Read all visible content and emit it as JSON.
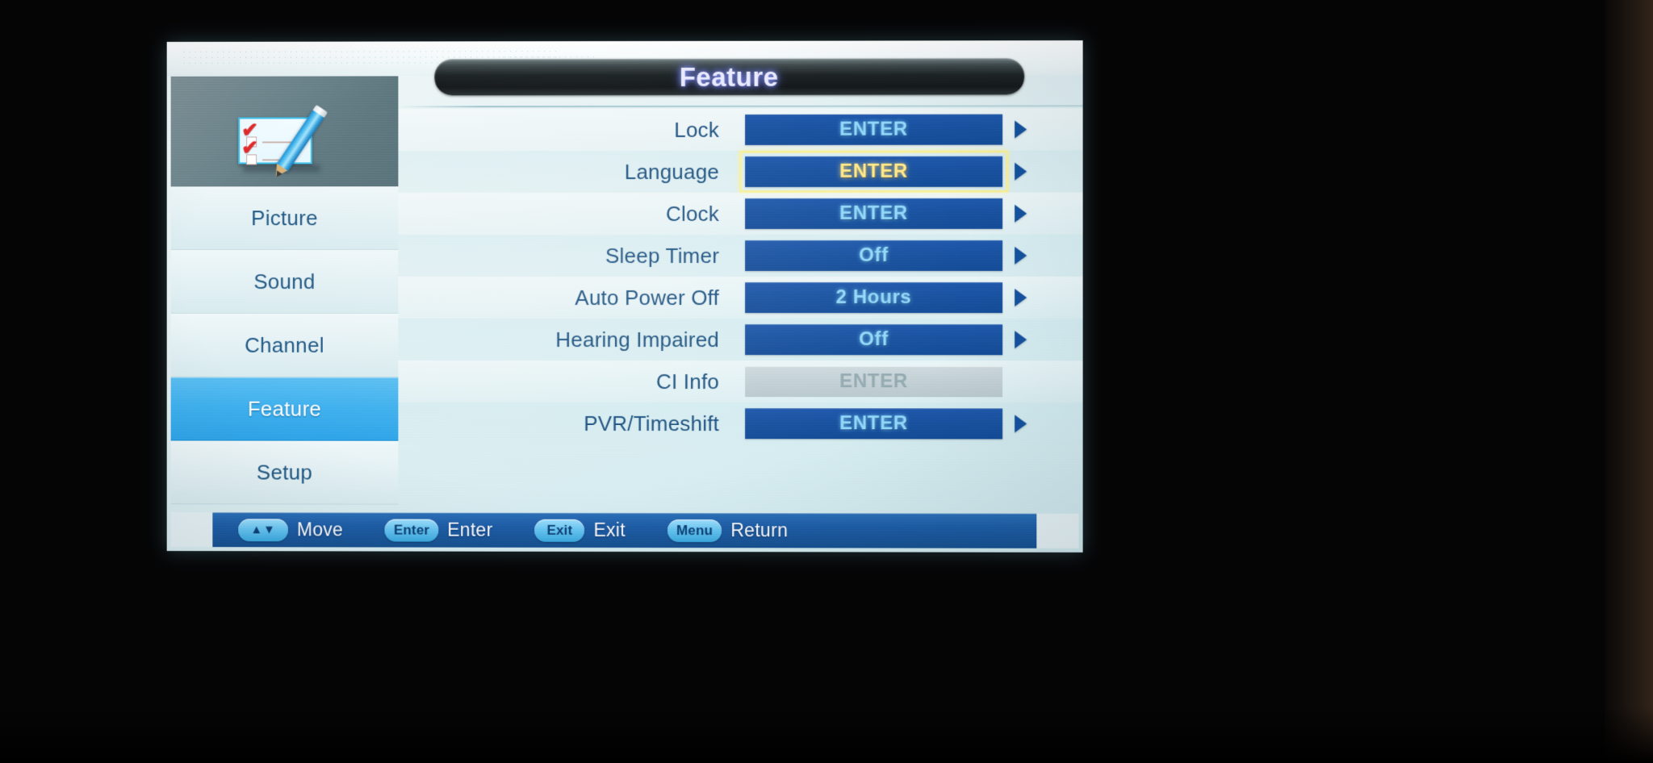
{
  "window": {
    "title": "Feature"
  },
  "sidebar": {
    "icon_name": "checklist-pencil-icon",
    "items": [
      {
        "label": "Picture",
        "active": false
      },
      {
        "label": "Sound",
        "active": false
      },
      {
        "label": "Channel",
        "active": false
      },
      {
        "label": "Feature",
        "active": true
      },
      {
        "label": "Setup",
        "active": false
      }
    ]
  },
  "main": {
    "options": [
      {
        "label": "Lock",
        "value": "ENTER",
        "selected": false,
        "disabled": false,
        "arrow": true
      },
      {
        "label": "Language",
        "value": "ENTER",
        "selected": true,
        "disabled": false,
        "arrow": true
      },
      {
        "label": "Clock",
        "value": "ENTER",
        "selected": false,
        "disabled": false,
        "arrow": true
      },
      {
        "label": "Sleep Timer",
        "value": "Off",
        "selected": false,
        "disabled": false,
        "arrow": true
      },
      {
        "label": "Auto Power Off",
        "value": "2 Hours",
        "selected": false,
        "disabled": false,
        "arrow": true
      },
      {
        "label": "Hearing Impaired",
        "value": "Off",
        "selected": false,
        "disabled": false,
        "arrow": true
      },
      {
        "label": "CI Info",
        "value": "ENTER",
        "selected": false,
        "disabled": true,
        "arrow": false
      },
      {
        "label": "PVR/Timeshift",
        "value": "ENTER",
        "selected": false,
        "disabled": false,
        "arrow": true
      }
    ]
  },
  "helpbar": {
    "items": [
      {
        "key": "▲▼",
        "label": "Move",
        "key_style": "arrows"
      },
      {
        "key": "Enter",
        "label": "Enter",
        "key_style": "word"
      },
      {
        "key": "Exit",
        "label": "Exit",
        "key_style": "word"
      },
      {
        "key": "Menu",
        "label": "Return",
        "key_style": "word"
      }
    ]
  },
  "colors": {
    "accent_blue": "#18519f",
    "selected_outline": "#f7f09a",
    "sidebar_active": "#3fb0ee",
    "value_text": "#8fd7fb",
    "selected_value_text": "#ffe98a",
    "disabled_value_bg": "#c2d0d5",
    "label_text": "#1b4f7d",
    "panel_bg": "#dff0f3",
    "helpbar_bg": "#1d5ca6"
  }
}
